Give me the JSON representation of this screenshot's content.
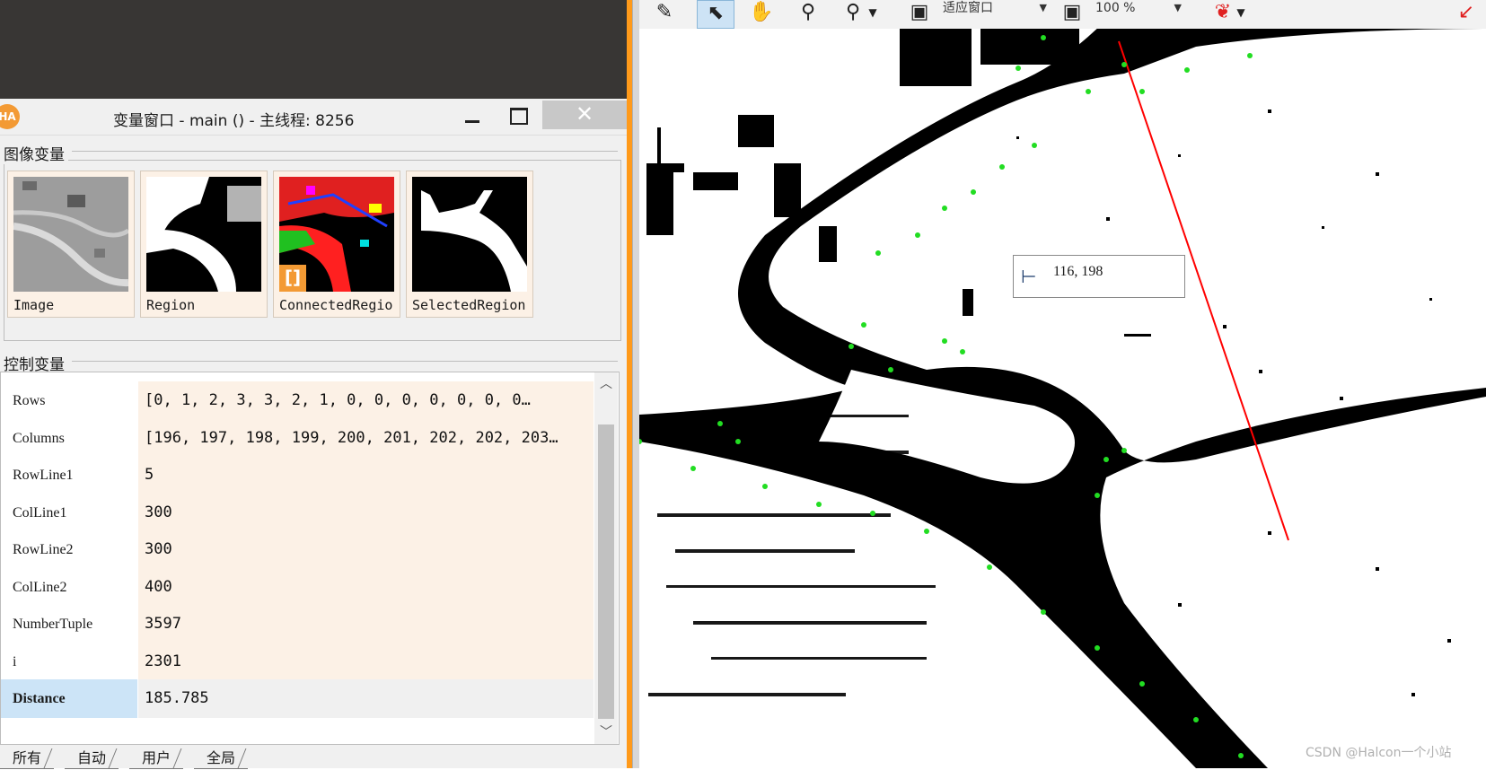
{
  "variable_window": {
    "app_icon": "HA",
    "title": "变量窗口 - main () - 主线程: 8256",
    "image_group_label": "图像变量",
    "control_group_label": "控制变量",
    "images": [
      {
        "label": "Image",
        "icon": "grayscale-aerial-image"
      },
      {
        "label": "Region",
        "icon": "binary-region-image"
      },
      {
        "label": "ConnectedRegio",
        "icon": "colored-connected-regions-image"
      },
      {
        "label": "SelectedRegion",
        "icon": "selected-region-image"
      }
    ],
    "control_variables": [
      {
        "name": "Rows",
        "value": "[0, 1, 2, 3, 3, 2, 1, 0, 0, 0, 0, 0, 0, 0…"
      },
      {
        "name": "Columns",
        "value": "[196, 197, 198, 199, 200, 201, 202, 202, 203…"
      },
      {
        "name": "RowLine1",
        "value": "5"
      },
      {
        "name": "ColLine1",
        "value": "300"
      },
      {
        "name": "RowLine2",
        "value": "300"
      },
      {
        "name": "ColLine2",
        "value": "400"
      },
      {
        "name": "NumberTuple",
        "value": "3597"
      },
      {
        "name": "i",
        "value": "2301"
      },
      {
        "name": "Distance",
        "value": "185.785"
      }
    ],
    "selected_variable": "Distance",
    "tabs": [
      "所有",
      "自动",
      "用户",
      "全局"
    ],
    "close_glyph": "✕"
  },
  "viewer_toolbar": {
    "tools": [
      "pencil-tool-icon",
      "pointer-tool-icon",
      "hand-pan-icon",
      "zoom-icon",
      "zoom-plus-icon"
    ],
    "zoom_fit_label": "适应窗口",
    "zoom_percent_label": "100 %"
  },
  "graphics_window": {
    "pixel_info": "116,  198",
    "watermark": "CSDN @Halcon一个小站"
  },
  "colors": {
    "accent_orange": "#ff9a1a",
    "selected_row": "#cce4f7",
    "value_cell_bg": "#fcf1e6",
    "region_color": "#000000",
    "line_color": "#ff0000",
    "contour_points": "#22dd22"
  }
}
